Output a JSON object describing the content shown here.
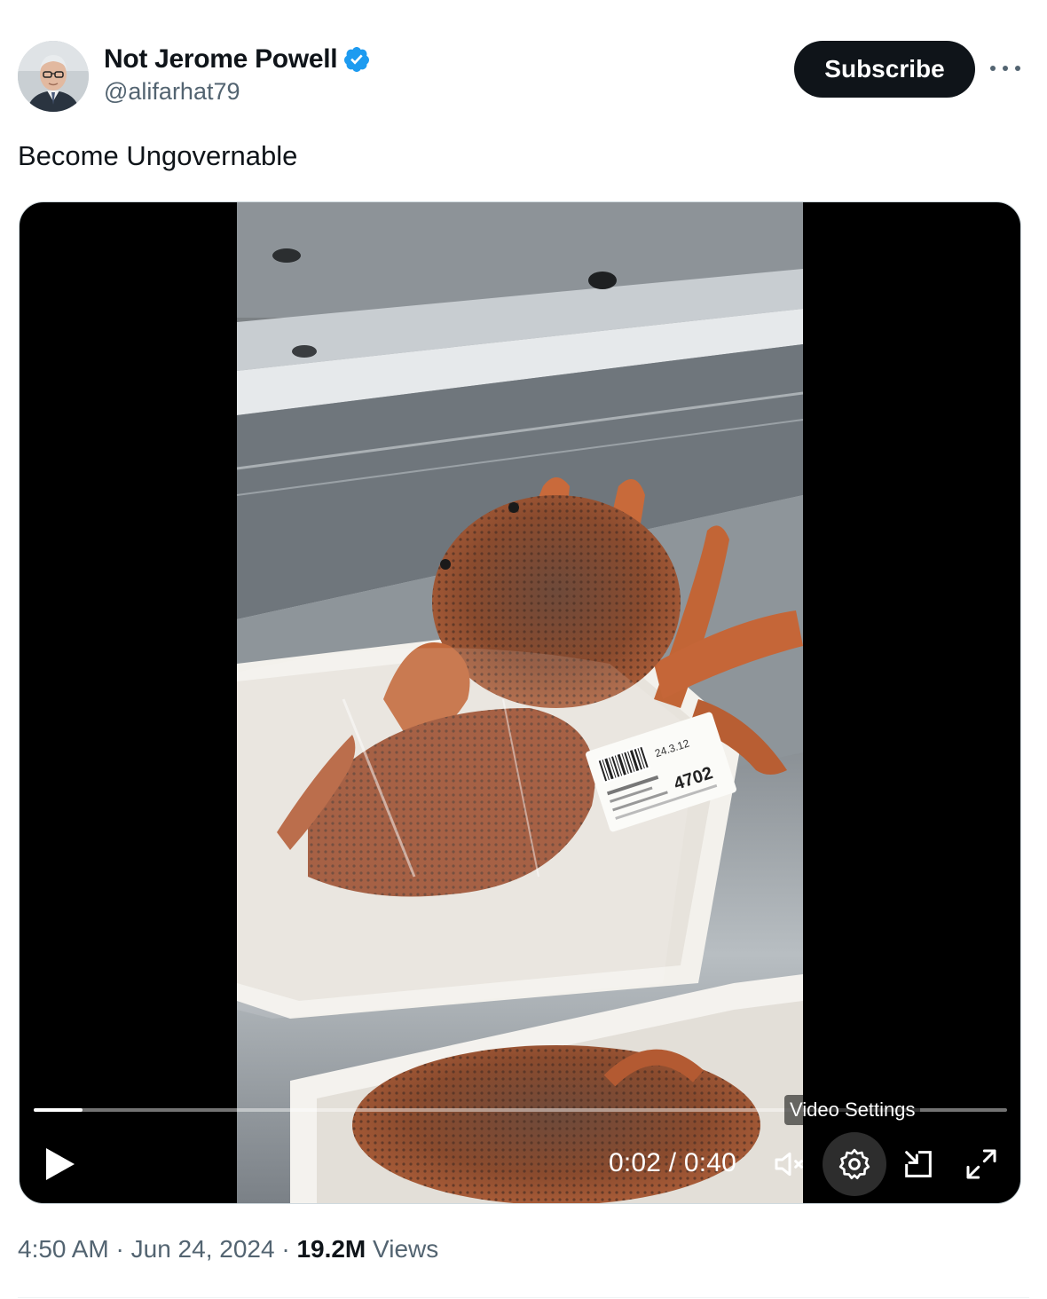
{
  "author": {
    "display_name": "Not Jerome Powell",
    "handle": "@alifarhat79",
    "verified": true,
    "avatar_icon": "avatar-portrait"
  },
  "subscribe_label": "Subscribe",
  "more_icon": "more-icon",
  "tweet_text": "Become Ungovernable",
  "video": {
    "current_time": "0:02",
    "separator": " / ",
    "duration": "0:40",
    "progress": 0.05,
    "tooltip": "Video Settings",
    "icons": [
      "play-icon",
      "mute-icon",
      "settings-icon",
      "pip-icon",
      "fullscreen-icon"
    ],
    "label_price": "4702",
    "label_date": "24.3.12"
  },
  "meta": {
    "time": "4:50 AM",
    "date": "Jun 24, 2024",
    "views_count": "19.2M",
    "views_label": "Views",
    "dot": "·"
  },
  "colors": {
    "text_primary": "#0f1419",
    "text_secondary": "#536471",
    "verified_blue": "#1d9bf0",
    "subscribe_bg": "#0f1419"
  }
}
